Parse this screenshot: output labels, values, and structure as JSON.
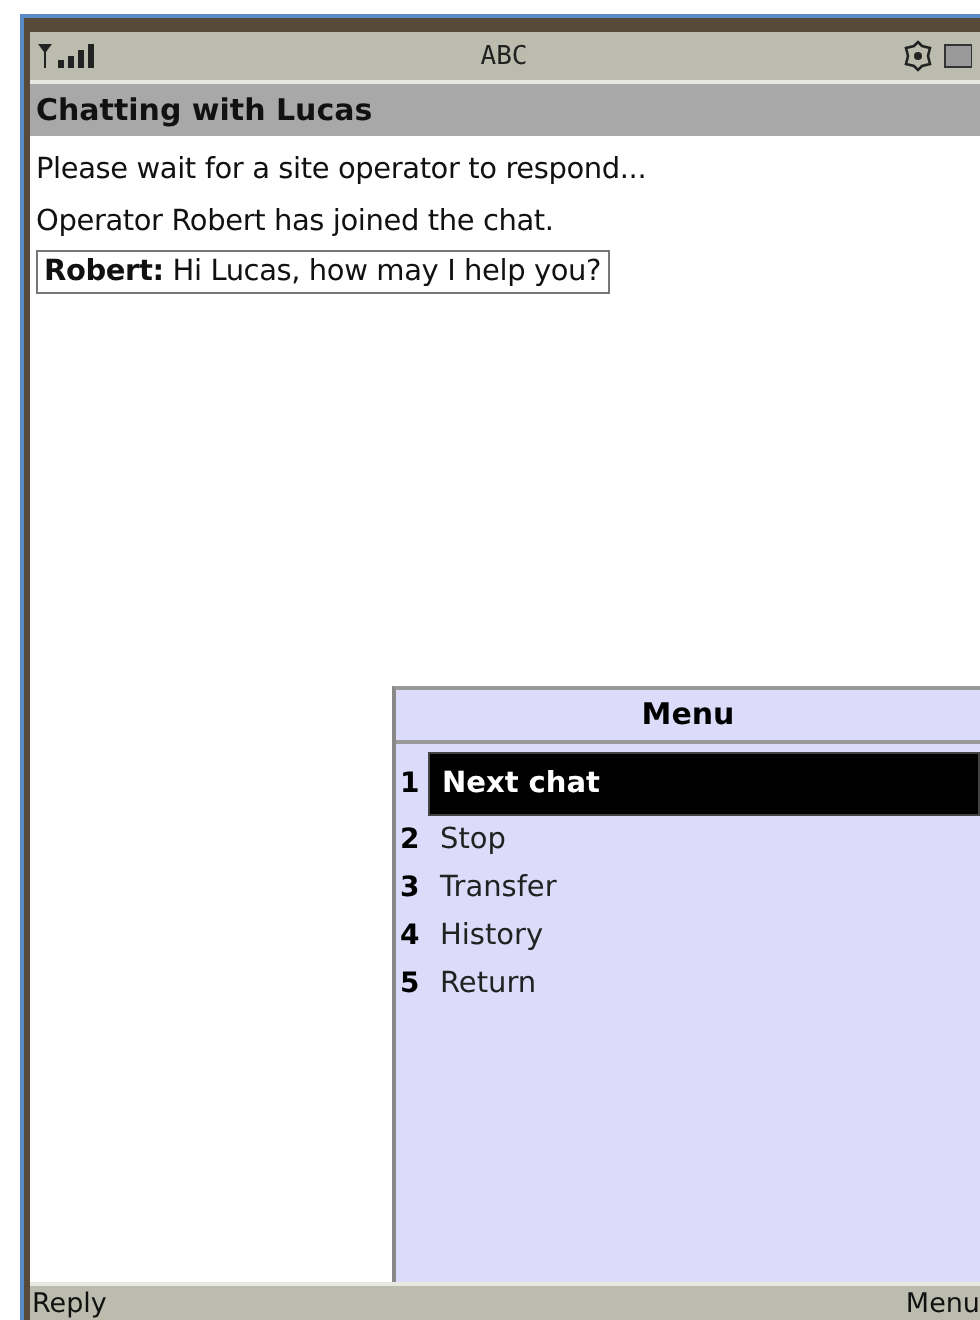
{
  "status_bar": {
    "input_mode": "ABC"
  },
  "title": "Chatting with Lucas",
  "messages": [
    {
      "kind": "system",
      "text": "Please wait for a site operator to respond..."
    },
    {
      "kind": "system",
      "text": "Operator Robert has joined the chat."
    },
    {
      "kind": "chat",
      "sender": "Robert:",
      "text": "Hi Lucas, how may I help you?"
    }
  ],
  "menu": {
    "title": "Menu",
    "items": [
      {
        "number": "1",
        "label": "Next chat",
        "selected": true
      },
      {
        "number": "2",
        "label": "Stop",
        "selected": false
      },
      {
        "number": "3",
        "label": "Transfer",
        "selected": false
      },
      {
        "number": "4",
        "label": "History",
        "selected": false
      },
      {
        "number": "5",
        "label": "Return",
        "selected": false
      }
    ]
  },
  "softkeys": {
    "left": "Reply",
    "right": "Menu"
  }
}
